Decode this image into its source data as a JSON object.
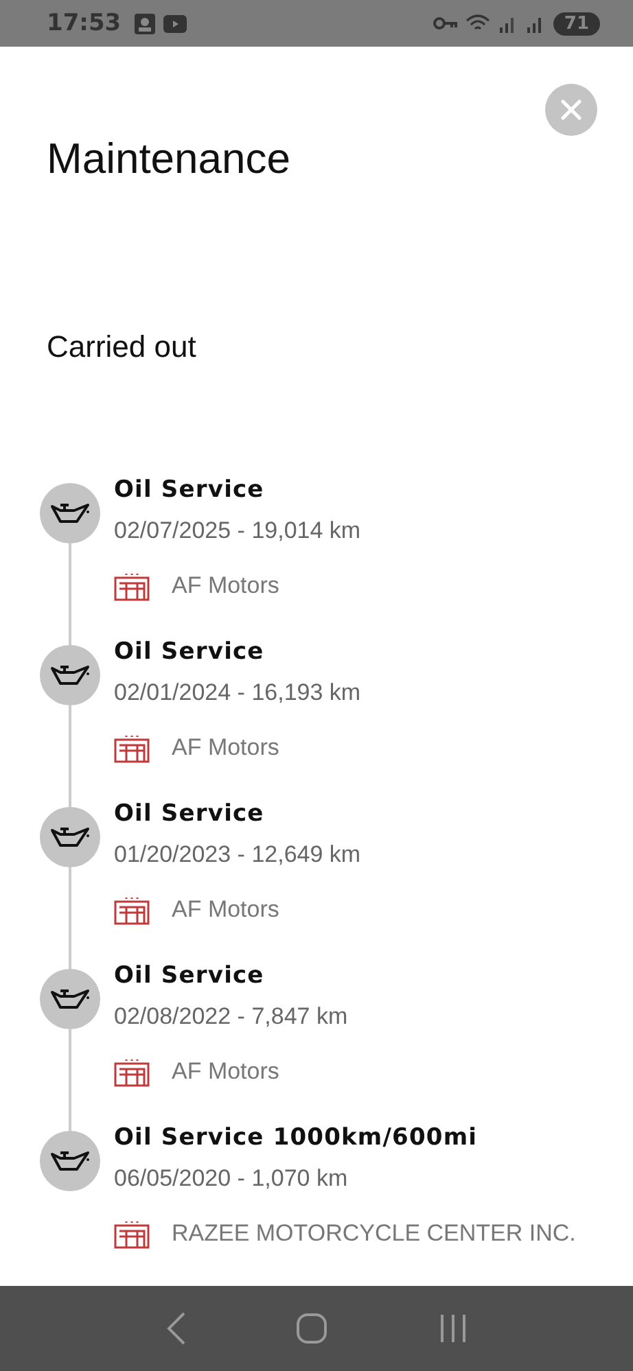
{
  "status_bar": {
    "time": "17:53",
    "battery": "71"
  },
  "title": "Maintenance",
  "section": "Carried out",
  "services": [
    {
      "name": "Oil Service",
      "date_mileage": "02/07/2025 - 19,014 km",
      "garage": "AF Motors"
    },
    {
      "name": "Oil Service",
      "date_mileage": "02/01/2024 - 16,193 km",
      "garage": "AF Motors"
    },
    {
      "name": "Oil Service",
      "date_mileage": "01/20/2023 - 12,649 km",
      "garage": "AF Motors"
    },
    {
      "name": "Oil Service",
      "date_mileage": "02/08/2022 - 7,847 km",
      "garage": "AF Motors"
    },
    {
      "name": "Oil Service 1000km/600mi",
      "date_mileage": "06/05/2020 - 1,070 km",
      "garage": "RAZEE MOTORCYCLE CENTER INC."
    }
  ]
}
